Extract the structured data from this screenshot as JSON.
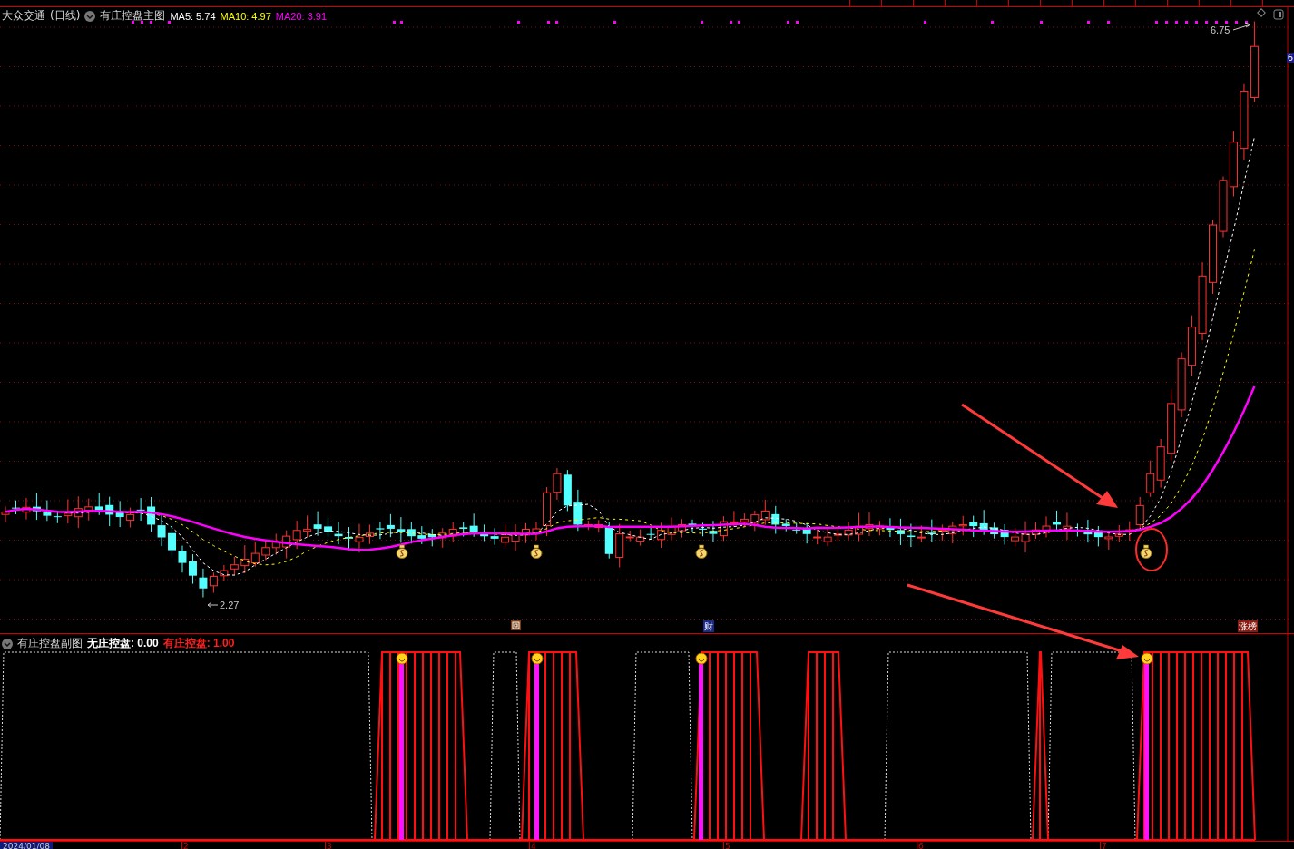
{
  "main_chart": {
    "stock_name": "大众交通",
    "period": "(日线)",
    "indicator": "有庄控盘主图",
    "ma": [
      {
        "label": "MA5: 5.74",
        "color": "#ffffff"
      },
      {
        "label": "MA10: 4.97",
        "color": "#ffff00"
      },
      {
        "label": "MA20: 3.91",
        "color": "#ff00ff"
      }
    ],
    "high_label": "6.75",
    "low_label": "2.27",
    "price_tag": "6",
    "markers": [
      {
        "text": "财",
        "kind": "finance"
      },
      {
        "text": "涨榜",
        "kind": "limit"
      }
    ]
  },
  "sub_chart": {
    "indicator": "有庄控盘副图",
    "values": [
      {
        "label": "无庄控盘: 0.00",
        "color": "#ffffff"
      },
      {
        "label": "有庄控盘: 1.00",
        "color": "#ff2020"
      }
    ]
  },
  "axis": {
    "date": "2024/01/08",
    "months": [
      "2",
      "3",
      "4",
      "5",
      "6",
      "7"
    ]
  }
}
